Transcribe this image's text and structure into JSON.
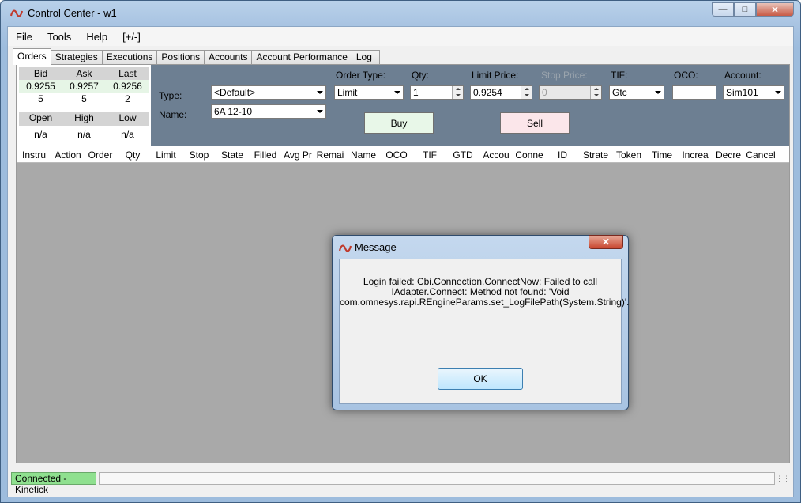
{
  "window": {
    "title": "Control Center - w1"
  },
  "menu": [
    {
      "label": "File"
    },
    {
      "label": "Tools"
    },
    {
      "label": "Help"
    },
    {
      "label": "[+/-]"
    }
  ],
  "tabs": [
    {
      "label": "Orders",
      "active": true
    },
    {
      "label": "Strategies"
    },
    {
      "label": "Executions"
    },
    {
      "label": "Positions"
    },
    {
      "label": "Accounts"
    },
    {
      "label": "Account Performance"
    },
    {
      "label": "Log"
    }
  ],
  "quote": {
    "headers1": [
      "Bid",
      "Ask",
      "Last"
    ],
    "prices": [
      "0.9255",
      "0.9257",
      "0.9256"
    ],
    "sizes": [
      "5",
      "5",
      "2"
    ],
    "headers2": [
      "Open",
      "High",
      "Low"
    ],
    "values2": [
      "n/a",
      "n/a",
      "n/a"
    ]
  },
  "entry": {
    "type_label": "Type:",
    "type_value": "<Default>",
    "name_label": "Name:",
    "name_value": "6A 12-10",
    "order_type_label": "Order Type:",
    "order_type_value": "Limit",
    "qty_label": "Qty:",
    "qty_value": "1",
    "limit_price_label": "Limit Price:",
    "limit_price_value": "0.9254",
    "stop_price_label": "Stop Price:",
    "stop_price_value": "0",
    "tif_label": "TIF:",
    "tif_value": "Gtc",
    "oco_label": "OCO:",
    "oco_value": "",
    "account_label": "Account:",
    "account_value": "Sim101",
    "buy_label": "Buy",
    "sell_label": "Sell",
    "buy_color": "#e8f7e8",
    "sell_color": "#fbe6ea"
  },
  "grid_columns": [
    "Instru",
    "Action",
    "Order",
    "Qty",
    "Limit",
    "Stop",
    "State",
    "Filled",
    "Avg Pr",
    "Remai",
    "Name",
    "OCO",
    "TIF",
    "GTD",
    "Accou",
    "Conne",
    "ID",
    "Strate",
    "Token",
    "Time",
    "Increa",
    "Decre",
    "Cancel"
  ],
  "status": {
    "connection": "Connected - Kinetick",
    "connection_color": "#8fe08f"
  },
  "dialog": {
    "title": "Message",
    "message_lines": [
      "Login failed: Cbi.Connection.ConnectNow: Failed to call",
      "IAdapter.Connect:  Method not found: 'Void",
      "com.omnesys.rapi.REngineParams.set_LogFilePath(System.String)'."
    ],
    "ok_label": "OK"
  }
}
